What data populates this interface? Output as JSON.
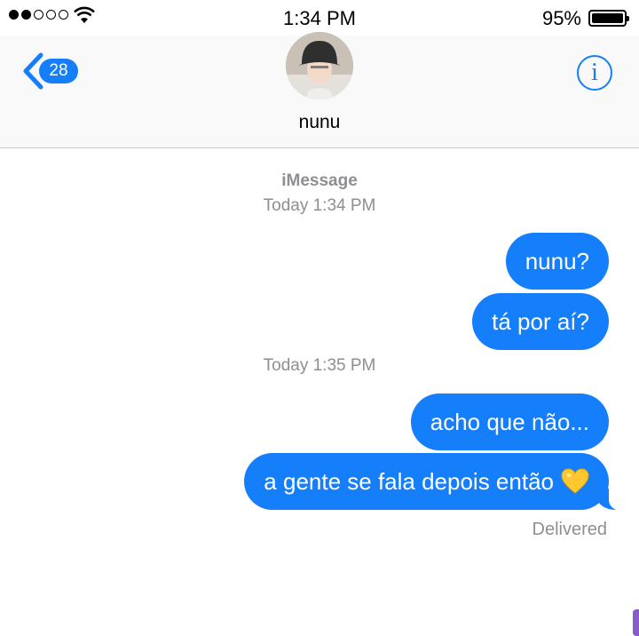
{
  "status_bar": {
    "signal_bars_filled": 2,
    "signal_bars_total": 5,
    "time": "1:34 PM",
    "battery_percent": "95%"
  },
  "header": {
    "back_count": "28",
    "contact_name": "nunu",
    "info_label": "i"
  },
  "conversation": {
    "service": "iMessage",
    "groups": [
      {
        "timestamp": "Today 1:34 PM",
        "messages": [
          "nunu?",
          "tá por aí?"
        ]
      },
      {
        "timestamp": "Today 1:35 PM",
        "messages": [
          "acho que não...",
          "a gente se fala depois então"
        ]
      }
    ],
    "last_message_emoji": "yellow-heart-icon",
    "delivery_status": "Delivered"
  },
  "colors": {
    "accent": "#147efb",
    "secondary_text": "#8e8e93",
    "header_bg": "#f9f9f9"
  }
}
